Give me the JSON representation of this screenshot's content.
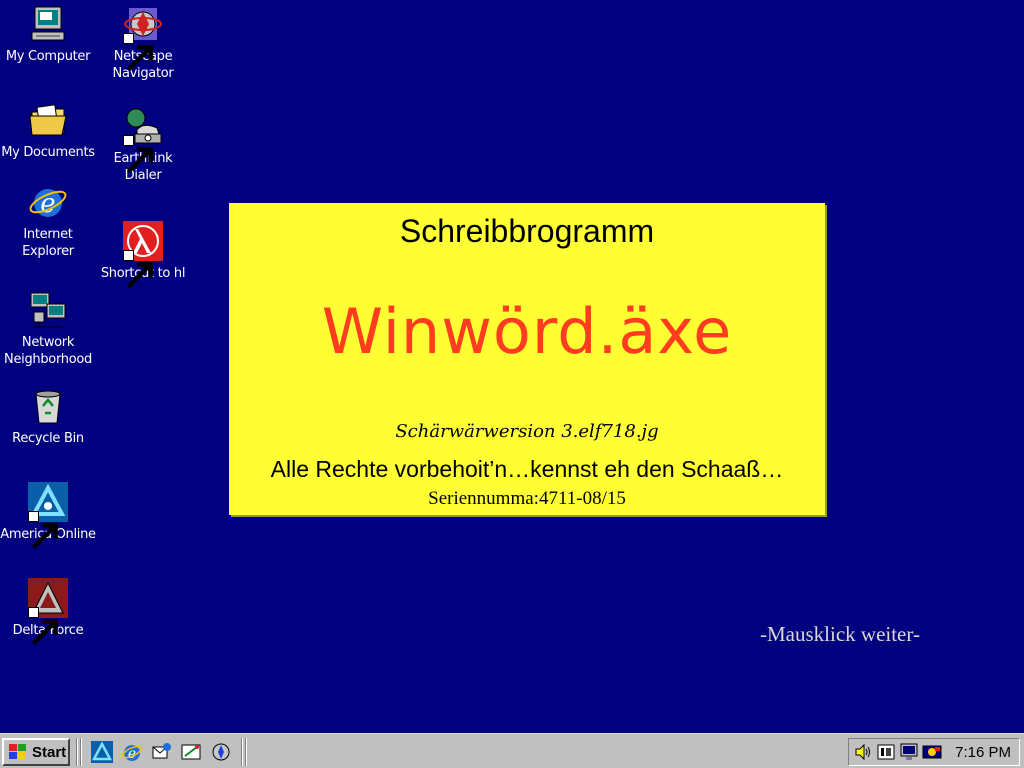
{
  "desktop": {
    "background": "#01017f",
    "icons": [
      {
        "label": "My Computer",
        "icon": "computer-icon"
      },
      {
        "label": "My Documents",
        "icon": "folder-icon"
      },
      {
        "label": "Internet\nExplorer",
        "icon": "internet-explorer-icon"
      },
      {
        "label": "Network\nNeighborhood",
        "icon": "network-icon"
      },
      {
        "label": "Recycle Bin",
        "icon": "recycle-bin-icon"
      },
      {
        "label": "America Online",
        "icon": "aol-icon"
      },
      {
        "label": "Delta Force",
        "icon": "delta-force-icon"
      },
      {
        "label": "Netscape\nNavigator",
        "icon": "netscape-icon"
      },
      {
        "label": "EarthLink\nDialer",
        "icon": "telephone-icon"
      },
      {
        "label": "Shortcut to hl",
        "icon": "half-life-icon"
      }
    ]
  },
  "splash": {
    "subtitle": "Schreibbrogramm",
    "app_name": "Winwörd.äxe",
    "version": "Schärwärwersion 3.elf718.jg",
    "rights": "Alle Rechte vorbehoit’n…kennst eh den Schaaß…",
    "serial": "Seriennumma:4711-08/15",
    "background": "#ffff33",
    "title_color": "#ff3c1f"
  },
  "continue_hint": "-Mausklick weiter-",
  "taskbar": {
    "start_label": "Start",
    "clock": "7:16 PM",
    "quick_launch": [
      "aol-icon",
      "internet-explorer-icon",
      "outlook-icon",
      "channels-icon",
      "netscape-icon"
    ],
    "tray": [
      "speaker-icon",
      "display-settings-icon",
      "monitor-icon",
      "scheduler-icon"
    ]
  }
}
